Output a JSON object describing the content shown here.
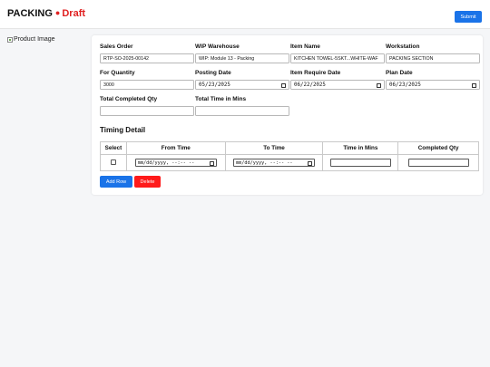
{
  "header": {
    "title": "PACKING",
    "status_dot": "●",
    "status": "Draft",
    "submit_label": "Submit"
  },
  "product_image": {
    "alt": "Product Image"
  },
  "form": {
    "sales_order": {
      "label": "Sales Order",
      "value": "RTP-SO-2025-00142"
    },
    "wip_warehouse": {
      "label": "WIP Warehouse",
      "value": "WIP: Module 13 - Packing"
    },
    "item_name": {
      "label": "Item Name",
      "value": "KITCHEN TOWEL-5SKT...WHITE-WAF"
    },
    "workstation": {
      "label": "Workstation",
      "value": "PACKING SECTION"
    },
    "for_quantity": {
      "label": "For Quantity",
      "value": "3000"
    },
    "posting_date": {
      "label": "Posting Date",
      "value": "05/23/2025"
    },
    "item_require_date": {
      "label": "Item Require Date",
      "value": "06/22/2025"
    },
    "plan_date": {
      "label": "Plan Date",
      "value": "06/23/2025"
    },
    "total_completed_qty": {
      "label": "Total Completed Qty",
      "value": ""
    },
    "total_time_in_mins": {
      "label": "Total Time in Mins",
      "value": ""
    }
  },
  "timing": {
    "title": "Timing Detail",
    "columns": [
      "Select",
      "From Time",
      "To Time",
      "Time in Mins",
      "Completed Qty"
    ],
    "row": {
      "from_time": "mm/dd/yyyy, --:-- --",
      "to_time": "mm/dd/yyyy, --:-- --",
      "time_in_mins": "",
      "completed_qty": ""
    },
    "add_row_label": "Add Row",
    "delete_label": "Delete"
  },
  "colors": {
    "primary": "#1a73e8",
    "danger": "#ff1a1a",
    "status": "#e02020"
  },
  "icons": {
    "date_picker": "calendar-icon",
    "image": "broken-image-icon"
  }
}
